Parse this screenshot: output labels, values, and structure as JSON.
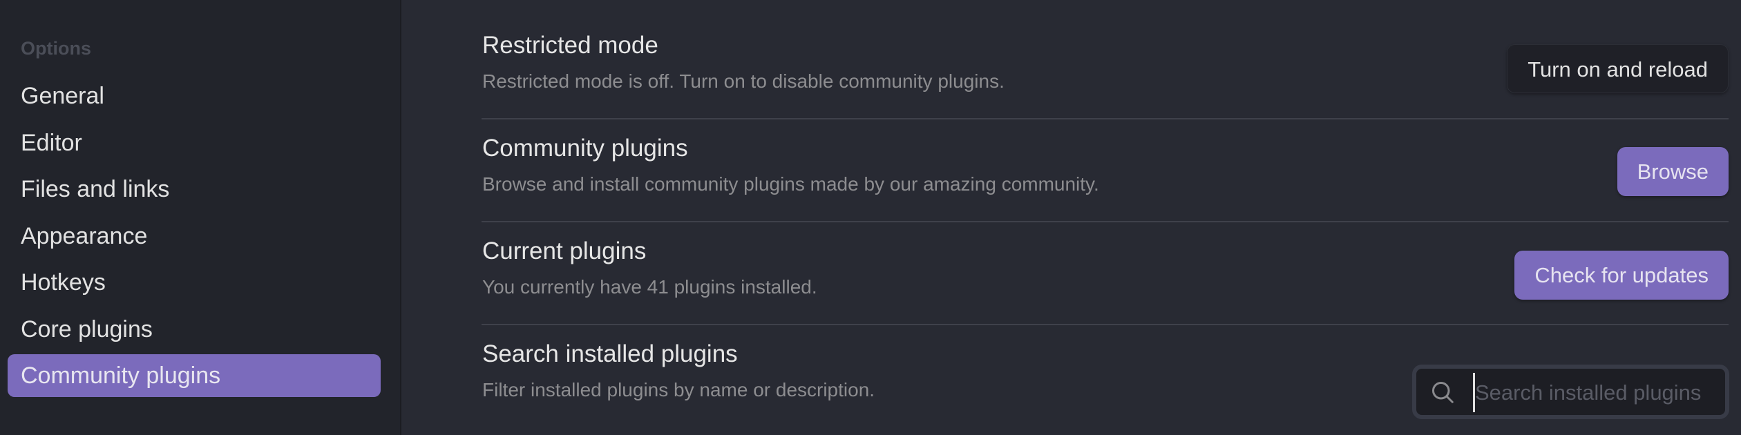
{
  "sidebar": {
    "heading": "Options",
    "items": [
      {
        "label": "General",
        "active": false
      },
      {
        "label": "Editor",
        "active": false
      },
      {
        "label": "Files and links",
        "active": false
      },
      {
        "label": "Appearance",
        "active": false
      },
      {
        "label": "Hotkeys",
        "active": false
      },
      {
        "label": "Core plugins",
        "active": false
      },
      {
        "label": "Community plugins",
        "active": true
      }
    ]
  },
  "settings": {
    "restricted_mode": {
      "name": "Restricted mode",
      "description": "Restricted mode is off. Turn on to disable community plugins.",
      "button_label": "Turn on and reload"
    },
    "community_plugins": {
      "name": "Community plugins",
      "description": "Browse and install community plugins made by our amazing community.",
      "button_label": "Browse"
    },
    "current_plugins": {
      "name": "Current plugins",
      "description": "You currently have 41 plugins installed.",
      "installed_count": 41,
      "button_label": "Check for updates"
    },
    "search_plugins": {
      "name": "Search installed plugins",
      "description": "Filter installed plugins by name or description.",
      "search_value": "",
      "search_placeholder": "Search installed plugins",
      "icon": "search-icon"
    }
  },
  "colors": {
    "accent": "#7b6bbc",
    "sidebar_bg": "#22242b",
    "main_bg": "#282a33",
    "divider": "#3f414b"
  }
}
